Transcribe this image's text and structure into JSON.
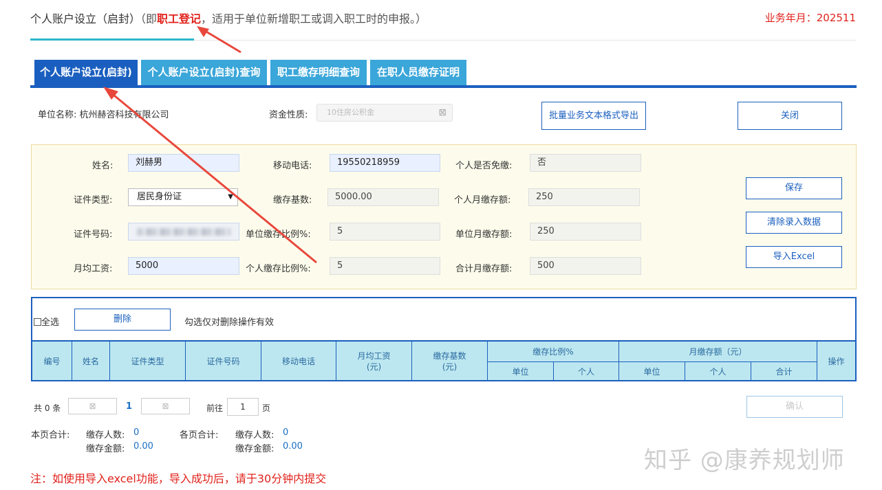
{
  "header": {
    "title_main": "个人账户设立（启封）",
    "title_paren_open": "（即",
    "title_highlight": "职工登记",
    "title_rest": "，适用于单位新增职工或调入职工时的申报。）",
    "year_label": "业务年月：202511"
  },
  "tabs": [
    {
      "label": "个人账户设立(启封)"
    },
    {
      "label": "个人账户设立(启封)查询"
    },
    {
      "label": "职工缴存明细查询"
    },
    {
      "label": "在职人员缴存证明"
    }
  ],
  "unit": {
    "name_label": "单位名称:",
    "name_value": "杭州赫咨科技有限公司",
    "fund_label": "资金性质:",
    "fund_value": "10住房公积金",
    "export_button": "批量业务文本格式导出",
    "close_button": "关闭"
  },
  "form": {
    "name_label": "姓名:",
    "name_value": "刘赫男",
    "phone_label": "移动电话:",
    "phone_value": "19550218959",
    "exempt_label": "个人是否免缴:",
    "exempt_value": "否",
    "idtype_label": "证件类型:",
    "idtype_value": "居民身份证",
    "base_label": "缴存基数:",
    "base_value": "5000.00",
    "personal_monthly_label": "个人月缴存额:",
    "personal_monthly_value": "250",
    "idno_label": "证件号码:",
    "unit_ratio_label": "单位缴存比例%:",
    "unit_ratio_value": "5",
    "unit_monthly_label": "单位月缴存额:",
    "unit_monthly_value": "250",
    "salary_label": "月均工资:",
    "salary_value": "5000",
    "personal_ratio_label": "个人缴存比例%:",
    "personal_ratio_value": "5",
    "total_monthly_label": "合计月缴存额:",
    "total_monthly_value": "500",
    "save_button": "保存",
    "clear_button": "清除录入数据",
    "import_button": "导入Excel"
  },
  "list": {
    "select_all": "全选",
    "delete_button": "删除",
    "hint": "勾选仅对删除操作有效",
    "columns": {
      "no": "编号",
      "name": "姓名",
      "idtype": "证件类型",
      "idno": "证件号码",
      "phone": "移动电话",
      "salary": "月均工资",
      "salary_unit": "(元)",
      "base": "缴存基数",
      "base_unit": "(元)",
      "ratio": "缴存比例%",
      "ratio_unit_col": "单位",
      "ratio_personal_col": "个人",
      "monthly": "月缴存额（元）",
      "monthly_unit_col": "单位",
      "monthly_personal_col": "个人",
      "monthly_total_col": "合计",
      "action": "操作"
    }
  },
  "pagination": {
    "total": "共 0 条",
    "current": "1",
    "goto_label": "前往",
    "goto_value": "1",
    "page_suffix": "页",
    "confirm_button": "确认"
  },
  "summary": {
    "page_total_label": "本页合计:",
    "all_total_label": "各页合计:",
    "count_label": "缴存人数:",
    "amount_label": "缴存金额:",
    "page_count": "0",
    "page_amount": "0.00",
    "all_count": "0",
    "all_amount": "0.00"
  },
  "note": "注：如使用导入excel功能，导入成功后，请于30分钟内提交",
  "watermark": "知乎 @康养规划师",
  "colors": {
    "accent_blue": "#1a5fbf",
    "tab_blue": "#3aa6d9",
    "highlight_red": "#e0211b",
    "panel_bg": "#fdfcec",
    "arrow_red": "#e8473c"
  }
}
